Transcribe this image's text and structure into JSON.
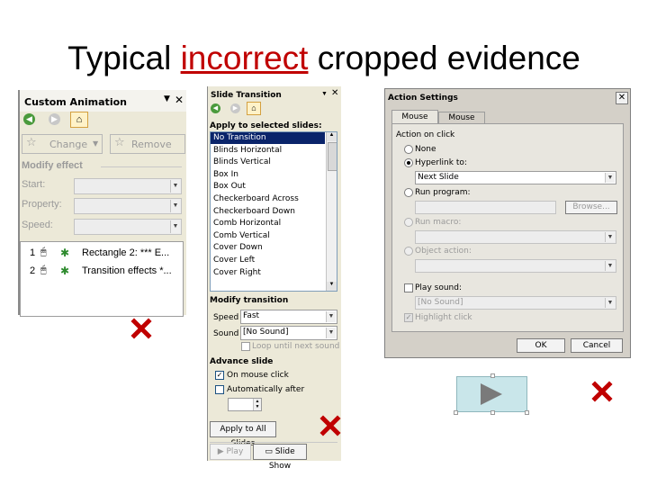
{
  "title": {
    "before": "Typical",
    "highlight": "incorrect",
    "after": "cropped evidence"
  },
  "custom_animation": {
    "header": "Custom Animation",
    "change_label": "Change",
    "remove_label": "Remove",
    "modify_label": "Modify effect",
    "start_label": "Start:",
    "property_label": "Property:",
    "speed_label": "Speed:",
    "items": [
      {
        "num": "1",
        "text": "Rectangle 2: *** E..."
      },
      {
        "num": "2",
        "text": "Transition effects *..."
      }
    ]
  },
  "slide_transition": {
    "header": "Slide Transition",
    "apply_label": "Apply to selected slides:",
    "transitions": [
      "No Transition",
      "Blinds Horizontal",
      "Blinds Vertical",
      "Box In",
      "Box Out",
      "Checkerboard Across",
      "Checkerboard Down",
      "Comb Horizontal",
      "Comb Vertical",
      "Cover Down",
      "Cover Left",
      "Cover Right"
    ],
    "modify_label": "Modify transition",
    "speed_label": "Speed",
    "speed_value": "Fast",
    "sound_label": "Sound",
    "sound_value": "[No Sound]",
    "loop_label": "Loop until next sound",
    "advance_label": "Advance slide",
    "on_click_label": "On mouse click",
    "auto_label": "Automatically after",
    "apply_all_label": "Apply to All Slides",
    "play_label": "Play",
    "slideshow_label": "Slide Show"
  },
  "action_settings": {
    "title": "Action Settings",
    "tab_click": "Mouse Click",
    "tab_over": "Mouse Over",
    "group_label": "Action on click",
    "none_label": "None",
    "hyperlink_label": "Hyperlink to:",
    "hyperlink_value": "Next Slide",
    "run_program_label": "Run program:",
    "browse_label": "Browse...",
    "run_macro_label": "Run macro:",
    "object_action_label": "Object action:",
    "play_sound_label": "Play sound:",
    "sound_value": "[No Sound]",
    "highlight_label": "Highlight click",
    "ok_label": "OK",
    "cancel_label": "Cancel"
  },
  "colors": {
    "accent": "#c00000",
    "selection": "#0a246a",
    "panel": "#ece9d8",
    "dialog": "#d4d0c8",
    "action_button": "#c9e6ea"
  }
}
